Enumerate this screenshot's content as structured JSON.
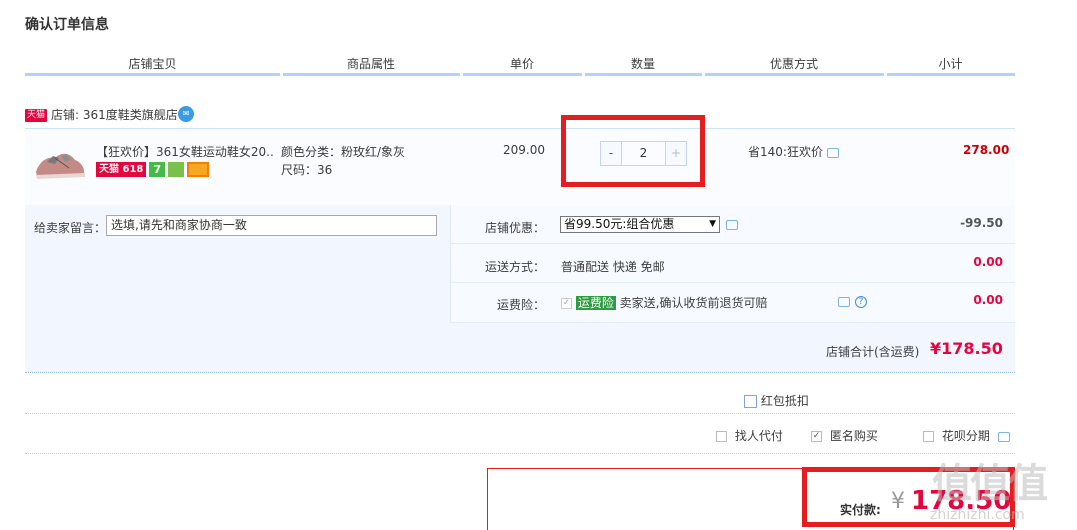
{
  "page_title": "确认订单信息",
  "columns": [
    "店铺宝贝",
    "商品属性",
    "单价",
    "数量",
    "优惠方式",
    "小计"
  ],
  "shop": {
    "badge": "天猫",
    "label": "店铺:",
    "name": "361度鞋类旗舰店"
  },
  "item": {
    "title": "【狂欢价】361女鞋运动鞋女20...",
    "badge_tmall": "天猫 618",
    "badge_7": "7",
    "attr_color": "颜色分类：粉玫红/象灰",
    "attr_size": "尺码：36",
    "price": "209.00",
    "qty_minus": "-",
    "qty_value": "2",
    "qty_plus": "+",
    "discount": "省140:狂欢价",
    "subtotal": "278.00"
  },
  "message": {
    "label": "给卖家留言：",
    "value": "选填,请先和商家协商一致"
  },
  "shop_discount": {
    "label": "店铺优惠：",
    "selected": "省99.50元:组合优惠",
    "value": "-99.50"
  },
  "shipping": {
    "label": "运送方式：",
    "method": "普通配送 快递 免邮",
    "value": "0.00"
  },
  "insurance": {
    "label": "运费险：",
    "tag": "运费险",
    "desc": "卖家送,确认收货前退货可赔",
    "value": "0.00"
  },
  "shop_total": {
    "label": "店铺合计(含运费)",
    "value": "¥178.50"
  },
  "hongbao": {
    "label": "红包抵扣"
  },
  "options": {
    "proxy": "找人代付",
    "anonymous": "匿名购买",
    "huabei": "花呗分期"
  },
  "payment": {
    "label": "实付款:",
    "currency": "¥",
    "value": "178.50"
  },
  "watermark": {
    "logo": "值值值",
    "url": "zhizhizhi.com"
  }
}
